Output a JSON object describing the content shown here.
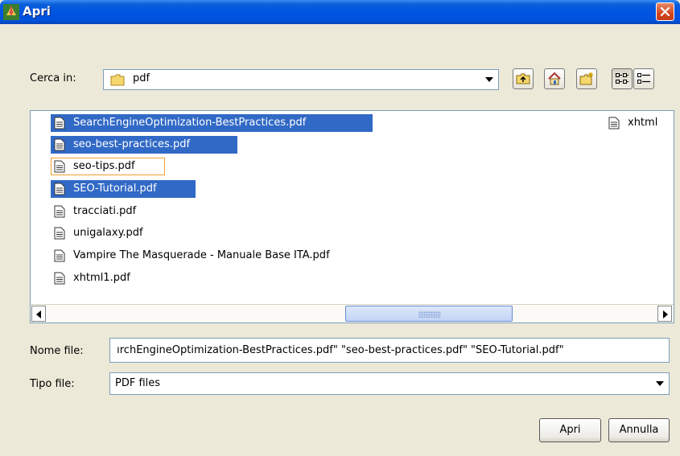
{
  "window": {
    "title": "Apri"
  },
  "lookin": {
    "label": "Cerca in:",
    "value": "pdf"
  },
  "toolbar": {
    "icons": [
      "up-folder-icon",
      "home-icon",
      "new-folder-icon",
      "list-view-icon",
      "details-view-icon"
    ]
  },
  "files": [
    {
      "name": "SearchEngineOptimization-BestPractices.pdf",
      "selected": true
    },
    {
      "name": "seo-best-practices.pdf",
      "selected": true
    },
    {
      "name": "seo-tips.pdf",
      "selected": false,
      "focused": true
    },
    {
      "name": "SEO-Tutorial.pdf",
      "selected": true
    },
    {
      "name": "tracciati.pdf",
      "selected": false
    },
    {
      "name": "unigalaxy.pdf",
      "selected": false
    },
    {
      "name": "Vampire The Masquerade - Manuale Base ITA.pdf",
      "selected": false
    },
    {
      "name": "xhtml1.pdf",
      "selected": false
    },
    {
      "name": "xhtml",
      "selected": false
    }
  ],
  "filename": {
    "label": "Nome file:",
    "value": " ırchEngineOptimization-BestPractices.pdf\" \"seo-best-practices.pdf\" \"SEO-Tutorial.pdf\""
  },
  "filetype": {
    "label": "Tipo file:",
    "value": "PDF files"
  },
  "buttons": {
    "open": "Apri",
    "cancel": "Annulla"
  },
  "colors": {
    "selection": "#3169c6",
    "titlebar": "#0054e3",
    "dialog": "#ece9d8",
    "focus": "#f0a030"
  }
}
